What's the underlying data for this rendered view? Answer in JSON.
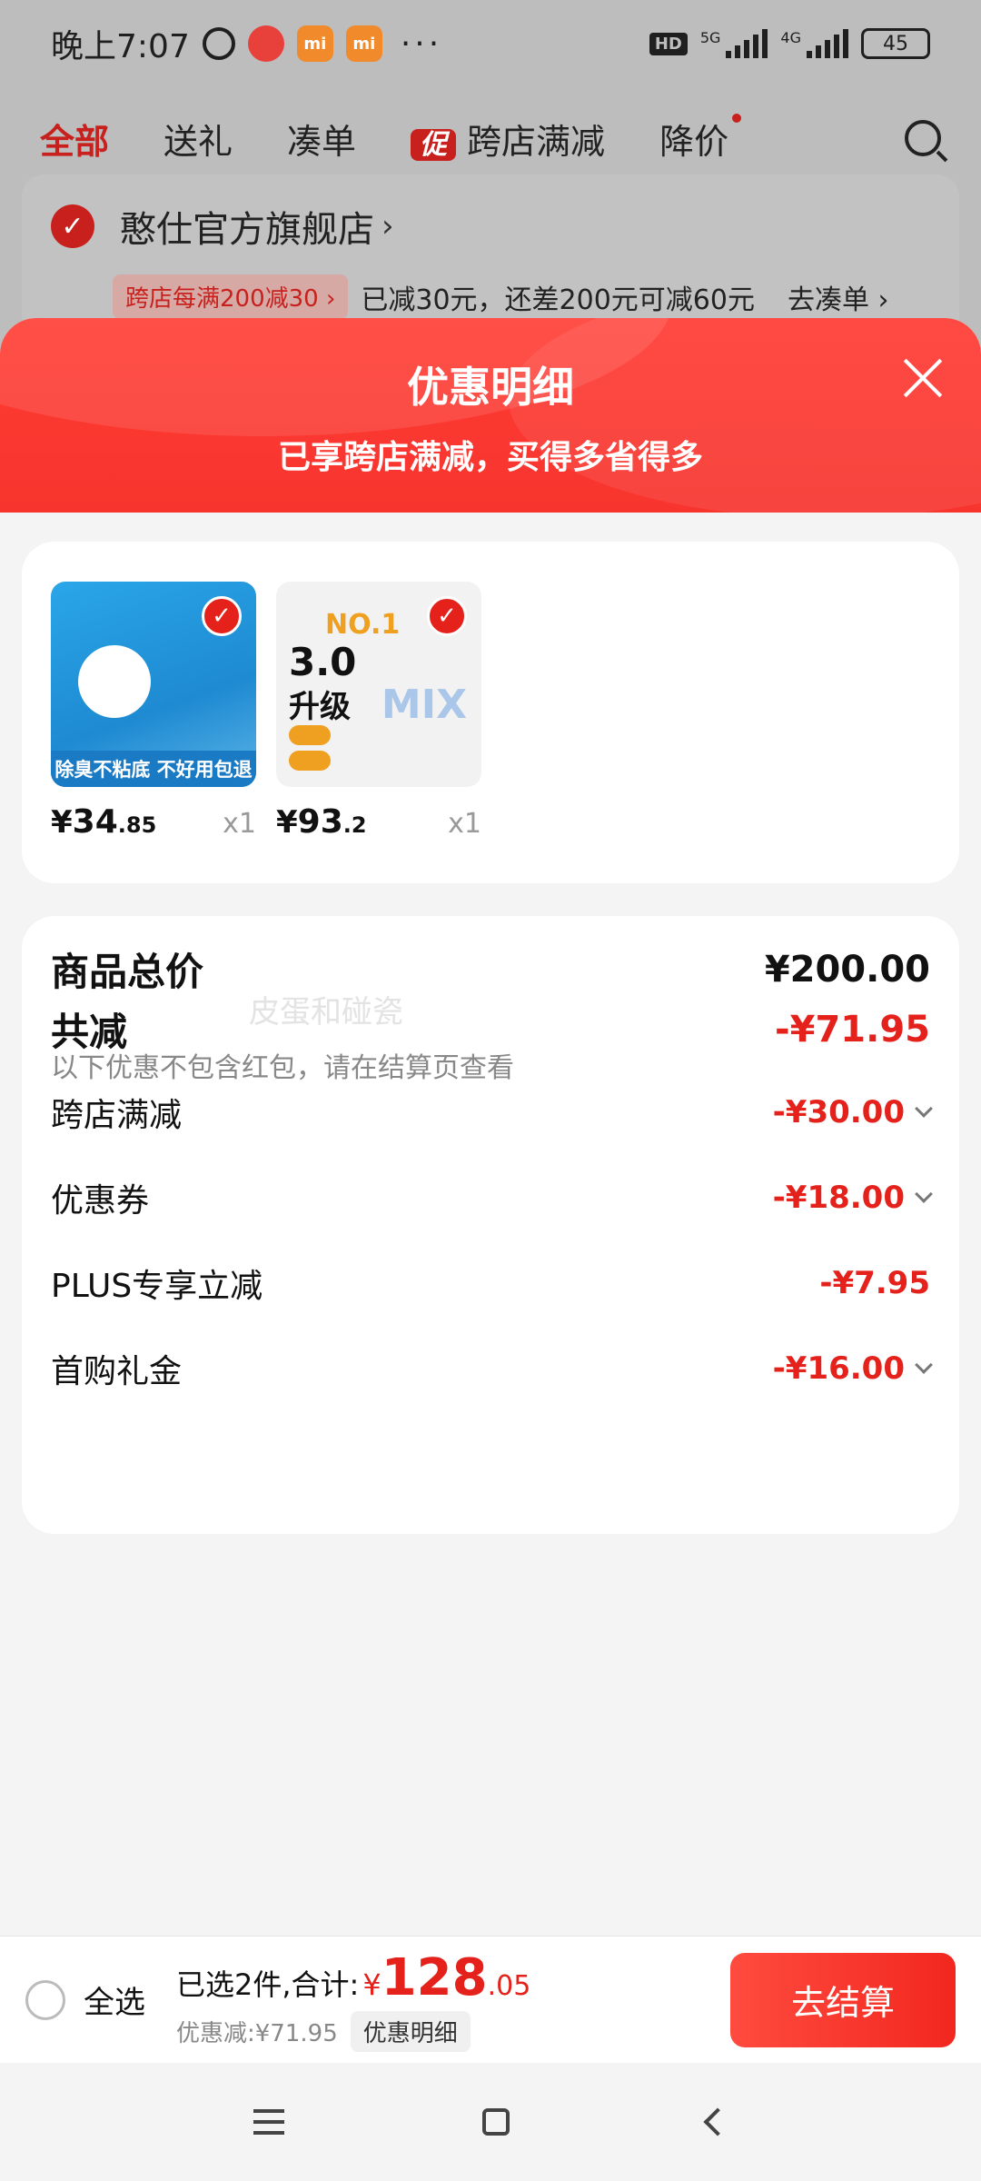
{
  "status_bar": {
    "time": "晚上7:07",
    "app_icon_label": "mi",
    "more": "···",
    "hd": "HD",
    "net1": "5G",
    "net2": "4G",
    "battery": "45"
  },
  "background": {
    "tabs": [
      "全部",
      "送礼",
      "凑单",
      "跨店满减",
      "降价"
    ],
    "promo_badge": "促",
    "store_name": "憨仕官方旗舰店",
    "store_chevron": "›",
    "promo_tag": "跨店每满200减30 ›",
    "promo_text": "已减30元，还差200元可减60元",
    "promo_link": "去凑单 ›"
  },
  "sheet": {
    "title": "优惠明细",
    "subtitle": "已享跨店满减，买得多省得多"
  },
  "products": [
    {
      "price_symbol": "¥",
      "price_int": "34",
      "price_dec": ".85",
      "qty": "x1",
      "banner": "除臭不粘底 不好用包退"
    },
    {
      "price_symbol": "¥",
      "price_int": "93",
      "price_dec": ".2",
      "qty": "x1",
      "img_title": "3.0",
      "img_sub": "升级",
      "img_brand": "NO.1",
      "img_mix": "MIX"
    }
  ],
  "summary": {
    "total_label": "商品总价",
    "total_value": "¥200.00",
    "watermark": "皮蛋和碰瓷",
    "discount_label": "共减",
    "discount_value": "-¥71.95",
    "note": "以下优惠不包含红包，请在结算页查看",
    "items": [
      {
        "label": "跨店满减",
        "value": "-¥30.00",
        "expandable": true
      },
      {
        "label": "优惠券",
        "value": "-¥18.00",
        "expandable": true
      },
      {
        "label": "PLUS专享立减",
        "value": "-¥7.95",
        "expandable": false
      },
      {
        "label": "首购礼金",
        "value": "-¥16.00",
        "expandable": true
      }
    ]
  },
  "bottom_bar": {
    "select_all": "全选",
    "selected_count": "已选2件,合计:",
    "total_symbol": "¥",
    "total_int": "128",
    "total_dec": ".05",
    "discount_text": "优惠减:¥71.95",
    "detail_label": "优惠明细",
    "checkout_label": "去结算"
  },
  "colors": {
    "accent": "#e4211b",
    "header_red": "#ff3b33"
  }
}
